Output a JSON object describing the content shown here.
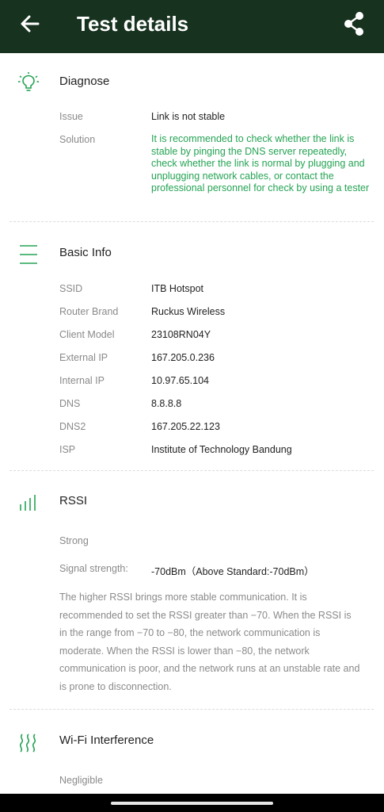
{
  "header": {
    "title": "Test details",
    "back_icon": "back-arrow-icon",
    "share_icon": "share-icon",
    "background": "#17321f"
  },
  "accent_color": "#24a353",
  "diagnose": {
    "title": "Diagnose",
    "icon": "lightbulb-icon",
    "issue_label": "Issue",
    "issue_value": "Link is not stable",
    "solution_label": "Solution",
    "solution_value": "It is recommended to check whether the link is stable by pinging the DNS server repeatedly, check whether the link is normal by plugging and unplugging network cables, or contact the professional personnel for check by using a tester"
  },
  "basic_info": {
    "title": "Basic Info",
    "icon": "lines-icon",
    "rows": [
      {
        "label": "SSID",
        "value": "ITB Hotspot"
      },
      {
        "label": "Router Brand",
        "value": "Ruckus Wireless"
      },
      {
        "label": "Client Model",
        "value": "23108RN04Y"
      },
      {
        "label": "External IP",
        "value": "167.205.0.236"
      },
      {
        "label": "Internal IP",
        "value": "10.97.65.104"
      },
      {
        "label": "DNS",
        "value": "8.8.8.8"
      },
      {
        "label": "DNS2",
        "value": "167.205.22.123"
      },
      {
        "label": "ISP",
        "value": "Institute of Technology Bandung"
      }
    ]
  },
  "rssi": {
    "title": "RSSI",
    "icon": "signal-bars-icon",
    "status": "Strong",
    "strength_label": "Signal strength:",
    "strength_value": "-70dBm（Above Standard:-70dBm）",
    "description": "The higher RSSI brings more stable communication. It is recommended to set the RSSI greater than −70. When the RSSI is in the range from −70 to −80, the network communication is moderate. When the RSSI is lower than −80, the network communication is poor, and the network runs at an unstable rate and is prone to disconnection."
  },
  "wifi_interference": {
    "title": "Wi-Fi Interference",
    "icon": "wavy-lines-icon",
    "status": "Negligible"
  }
}
